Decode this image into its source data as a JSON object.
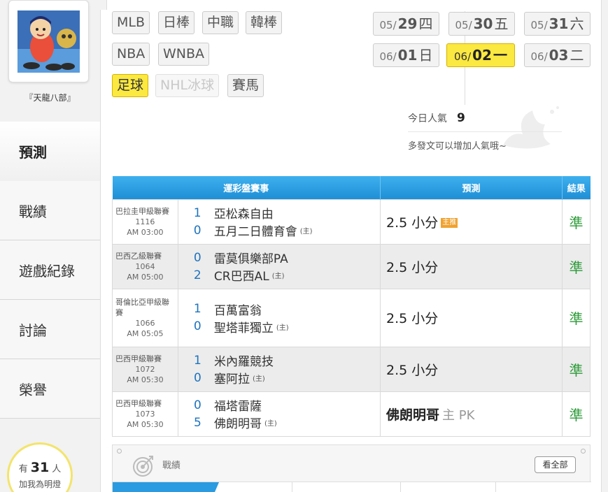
{
  "user": {
    "name": "『天龍八部』"
  },
  "nav": [
    {
      "label": "預測",
      "active": true
    },
    {
      "label": "戰績",
      "active": false
    },
    {
      "label": "遊戲紀錄",
      "active": false
    },
    {
      "label": "討論",
      "active": false
    },
    {
      "label": "榮譽",
      "active": false
    }
  ],
  "lamp": {
    "prefix": "有",
    "count": "31",
    "suffix": "人",
    "line2": "加我為明燈"
  },
  "sports": [
    {
      "label": "MLB",
      "state": "normal"
    },
    {
      "label": "日棒",
      "state": "normal"
    },
    {
      "label": "中職",
      "state": "normal"
    },
    {
      "label": "韓棒",
      "state": "normal"
    },
    {
      "label": "NBA",
      "state": "normal"
    },
    {
      "label": "WNBA",
      "state": "normal"
    },
    {
      "label": "足球",
      "state": "active"
    },
    {
      "label": "NHL冰球",
      "state": "disabled"
    },
    {
      "label": "賽馬",
      "state": "normal"
    }
  ],
  "dates": [
    {
      "month": "05/",
      "day": "29",
      "weekday": "四",
      "active": false
    },
    {
      "month": "05/",
      "day": "30",
      "weekday": "五",
      "active": false
    },
    {
      "month": "05/",
      "day": "31",
      "weekday": "六",
      "active": false
    },
    {
      "month": "06/",
      "day": "01",
      "weekday": "日",
      "active": false
    },
    {
      "month": "06/",
      "day": "02",
      "weekday": "一",
      "active": true
    },
    {
      "month": "06/",
      "day": "03",
      "weekday": "二",
      "active": false
    }
  ],
  "popularity": {
    "label": "今日人氣",
    "value": "9",
    "hint": "多發文可以增加人氣哦~"
  },
  "table": {
    "headers": {
      "event": "運彩盤賽事",
      "prediction": "預測",
      "result": "結果"
    },
    "rows": [
      {
        "league": "巴拉圭甲級聯賽",
        "game_id": "1116",
        "time": "AM 03:00",
        "away": {
          "score": "1",
          "name": "亞松森自由",
          "home_mark": ""
        },
        "home": {
          "score": "0",
          "name": "五月二日體育會",
          "home_mark": "(主)"
        },
        "prediction": "2.5 小分",
        "badge": "主推",
        "result": "準"
      },
      {
        "league": "巴西乙級聯賽",
        "game_id": "1064",
        "time": "AM 05:00",
        "away": {
          "score": "0",
          "name": "雷莫俱樂部PA",
          "home_mark": ""
        },
        "home": {
          "score": "2",
          "name": "CR巴西AL",
          "home_mark": "(主)"
        },
        "prediction": "2.5 小分",
        "badge": "",
        "result": "準"
      },
      {
        "league": "哥倫比亞甲級聯賽",
        "game_id": "1066",
        "time": "AM 05:05",
        "away": {
          "score": "1",
          "name": "百萬富翁",
          "home_mark": ""
        },
        "home": {
          "score": "0",
          "name": "聖塔菲獨立",
          "home_mark": "(主)"
        },
        "prediction": "2.5 小分",
        "badge": "",
        "result": "準"
      },
      {
        "league": "巴西甲級聯賽",
        "game_id": "1072",
        "time": "AM 05:30",
        "away": {
          "score": "1",
          "name": "米內羅競技",
          "home_mark": ""
        },
        "home": {
          "score": "0",
          "name": "塞阿拉",
          "home_mark": "(主)"
        },
        "prediction": "2.5 小分",
        "badge": "",
        "result": "準"
      },
      {
        "league": "巴西甲級聯賽",
        "game_id": "1073",
        "time": "AM 05:30",
        "away": {
          "score": "0",
          "name": "福塔雷薩",
          "home_mark": ""
        },
        "home": {
          "score": "5",
          "name": "佛朗明哥",
          "home_mark": "(主)"
        },
        "prediction_team": "佛朗明哥",
        "prediction_note": "主 PK",
        "badge": "",
        "result": "準"
      }
    ]
  },
  "record": {
    "title": "戰績",
    "view_all": "看全部"
  },
  "colors": {
    "accent_yellow": "#fbe840",
    "header_blue": "#2a9be0",
    "score_blue": "#1e73be",
    "result_green": "#2e9b3a",
    "badge_orange": "#f0a22f"
  }
}
